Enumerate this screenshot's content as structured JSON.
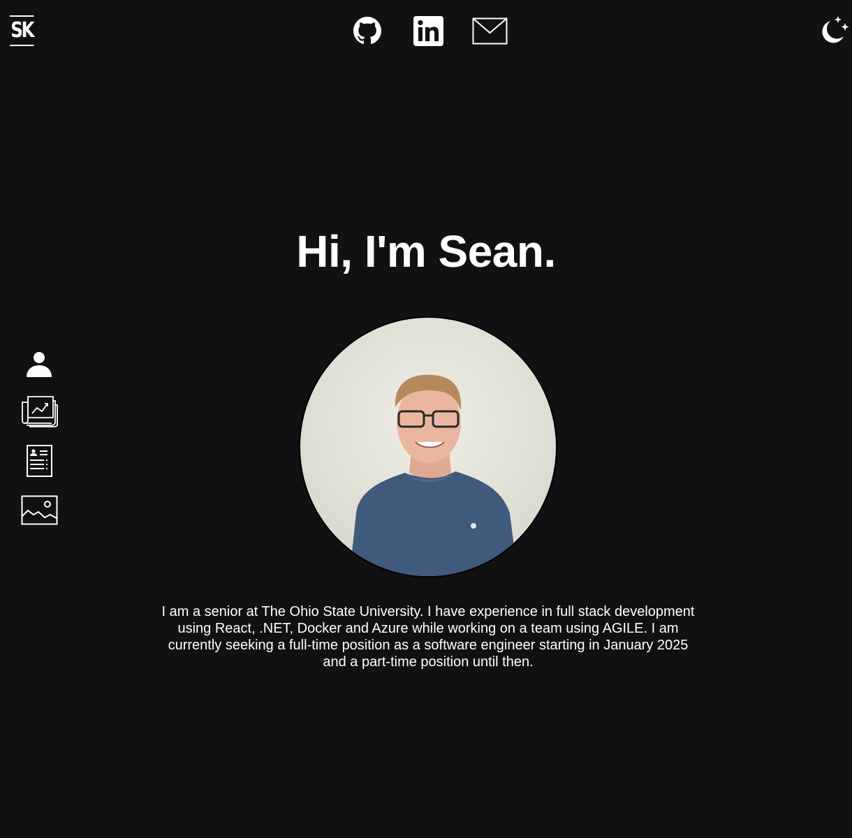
{
  "header": {
    "logo_text": "SK",
    "social_links": [
      {
        "name": "GitHub",
        "icon": "github-icon"
      },
      {
        "name": "LinkedIn",
        "icon": "linkedin-icon"
      },
      {
        "name": "Email",
        "icon": "mail-icon"
      }
    ],
    "theme_toggle_icon": "moon-stars-icon"
  },
  "side_nav": [
    {
      "icon": "person-icon"
    },
    {
      "icon": "newspaper-chart-icon"
    },
    {
      "icon": "resume-icon"
    },
    {
      "icon": "image-icon"
    }
  ],
  "main": {
    "heading": "Hi, I'm Sean.",
    "bio": "I am a senior at The Ohio State University. I have experience in full stack development using React, .NET, Docker and Azure while working on a team using AGILE. I am currently seeking a full-time position as a software engineer starting in January 2025 and a part-time position until then."
  },
  "colors": {
    "background": "#111113",
    "foreground": "#ffffff"
  }
}
